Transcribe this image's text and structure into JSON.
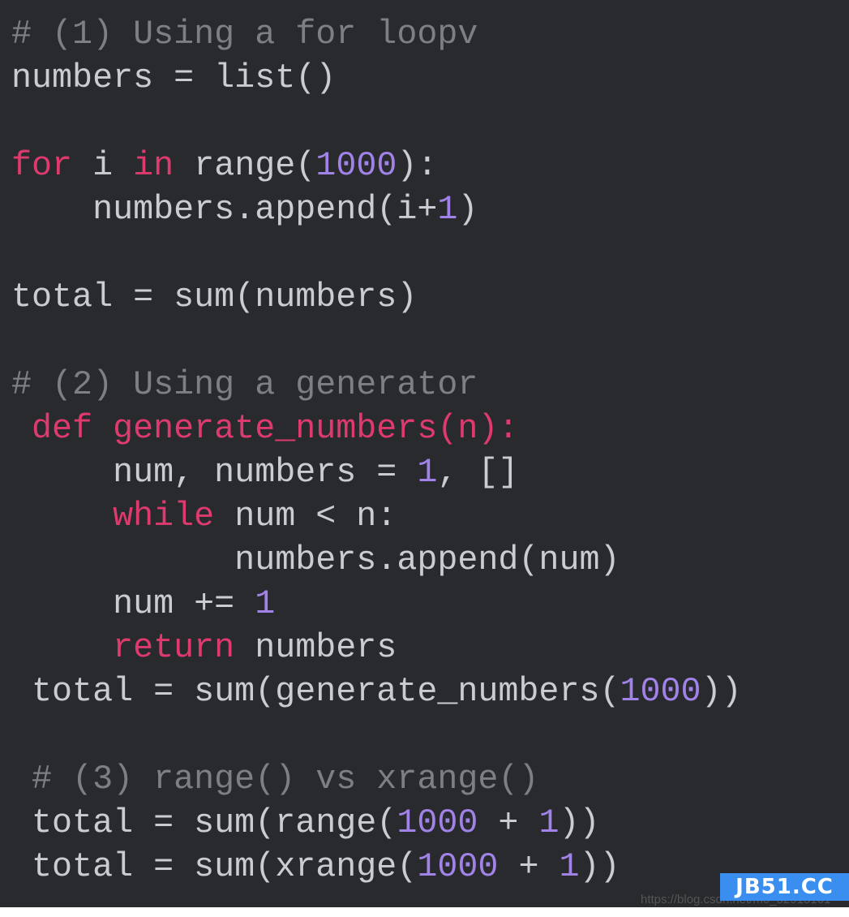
{
  "colors": {
    "background": "#282a2e",
    "text": "#c9cdd1",
    "keyword": "#df3a6e",
    "number": "#a182e6",
    "comment": "#7d7f82"
  },
  "code_lines": [
    [
      [
        "cm",
        "# (1) Using a for loopv"
      ]
    ],
    [
      [
        "t",
        "numbers = list()"
      ]
    ],
    [],
    [
      [
        "kw",
        "for"
      ],
      [
        "t",
        " i "
      ],
      [
        "kw",
        "in"
      ],
      [
        "t",
        " range("
      ],
      [
        "num",
        "1000"
      ],
      [
        "t",
        "):"
      ]
    ],
    [
      [
        "t",
        "    numbers.append(i+"
      ],
      [
        "num",
        "1"
      ],
      [
        "t",
        ")"
      ]
    ],
    [],
    [
      [
        "t",
        "total = sum(numbers)"
      ]
    ],
    [],
    [
      [
        "cm",
        "# (2) Using a generator"
      ]
    ],
    [
      [
        "kw",
        " def generate_numbers(n):"
      ]
    ],
    [
      [
        "t",
        "     num, numbers = "
      ],
      [
        "num",
        "1"
      ],
      [
        "t",
        ", []"
      ]
    ],
    [
      [
        "kw",
        "     while"
      ],
      [
        "t",
        " num < n:"
      ]
    ],
    [
      [
        "t",
        "           numbers.append(num)"
      ]
    ],
    [
      [
        "t",
        "     num += "
      ],
      [
        "num",
        "1"
      ]
    ],
    [
      [
        "kw",
        "     return"
      ],
      [
        "t",
        " numbers"
      ]
    ],
    [
      [
        "t",
        " total = sum(generate_numbers("
      ],
      [
        "num",
        "1000"
      ],
      [
        "t",
        "))"
      ]
    ],
    [],
    [
      [
        "cm",
        " # (3) range() vs xrange()"
      ]
    ],
    [
      [
        "t",
        " total = sum(range("
      ],
      [
        "num",
        "1000"
      ],
      [
        "t",
        " + "
      ],
      [
        "num",
        "1"
      ],
      [
        "t",
        "))"
      ]
    ],
    [
      [
        "t",
        " total = sum(xrange("
      ],
      [
        "num",
        "1000"
      ],
      [
        "t",
        " + "
      ],
      [
        "num",
        "1"
      ],
      [
        "t",
        "))"
      ]
    ]
  ],
  "watermark": {
    "logo": "JB51.CC",
    "url": "https://blog.csdn.net/m0_52915161"
  }
}
